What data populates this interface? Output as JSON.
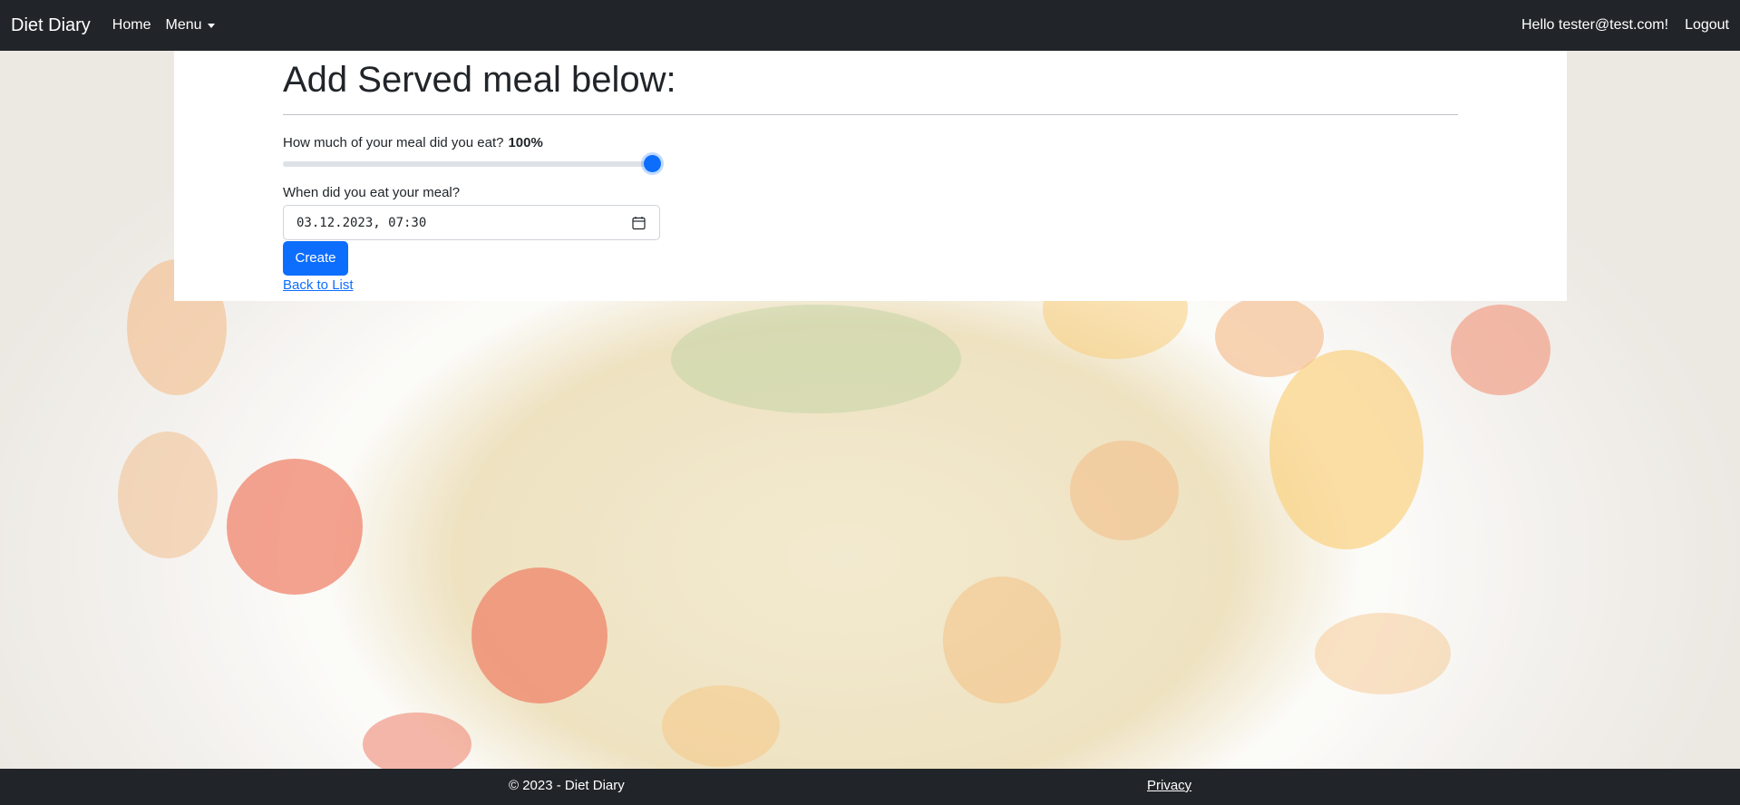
{
  "navbar": {
    "brand": "Diet Diary",
    "home_label": "Home",
    "menu_label": "Menu",
    "greeting": "Hello tester@test.com!",
    "logout_label": "Logout"
  },
  "form": {
    "title": "Add Served meal below:",
    "portion_question": "How much of your meal did you eat?",
    "portion_value_text": "100%",
    "portion_value": 1.0,
    "datetime_question": "When did you eat your meal?",
    "datetime_value": "03.12.2023, 07:30",
    "create_label": "Create",
    "back_label": "Back to List"
  },
  "footer": {
    "copyright": "© 2023 - Diet Diary",
    "privacy_label": "Privacy"
  },
  "colors": {
    "navbar_bg": "#212529",
    "primary": "#0d6efd",
    "card_bg": "#ffffff"
  }
}
